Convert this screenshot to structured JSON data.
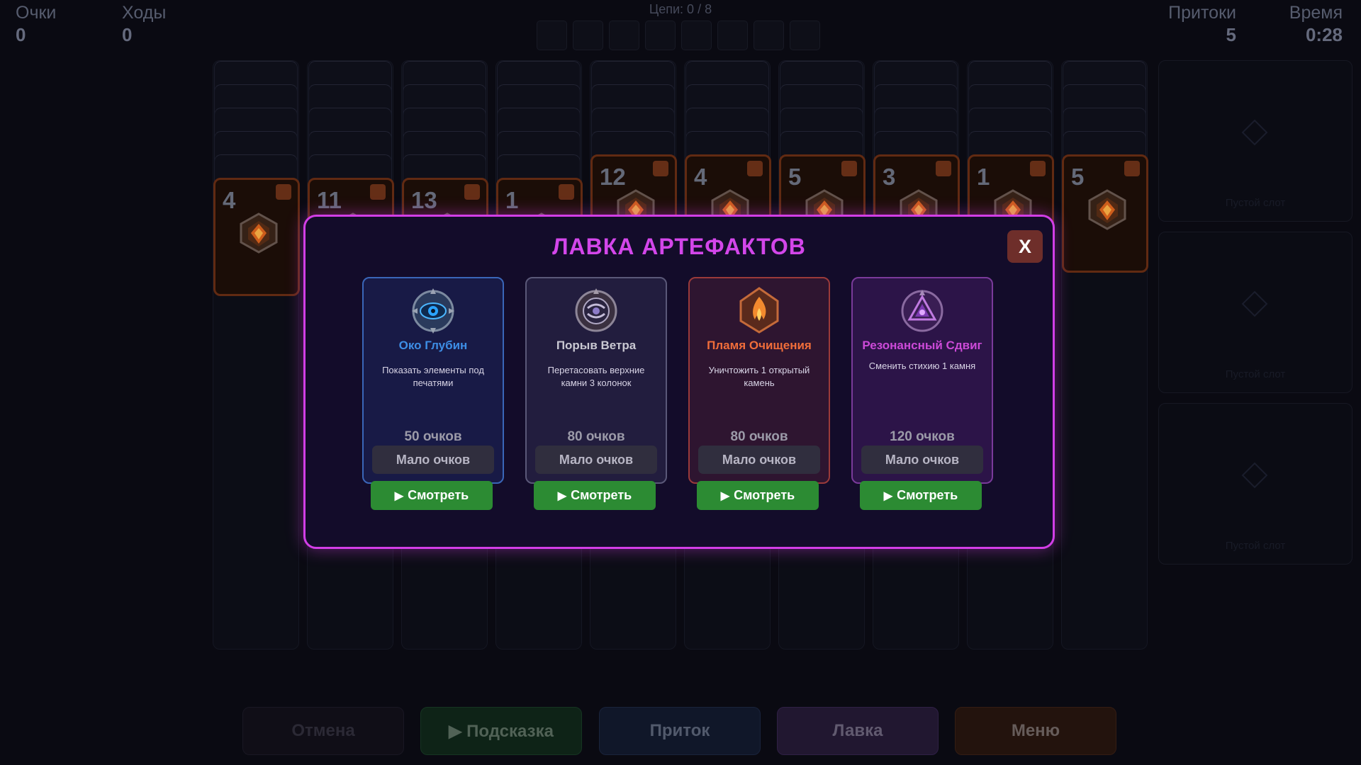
{
  "hud": {
    "score_label": "Очки",
    "score_value": "0",
    "moves_label": "Ходы",
    "moves_value": "0",
    "chains_label": "Цепи: 0 / 8",
    "streams_label": "Притоки",
    "streams_value": "5",
    "time_label": "Время",
    "time_value": "0:28"
  },
  "columns": [
    {
      "facedown": 5,
      "top_value": "4"
    },
    {
      "facedown": 5,
      "top_value": "11"
    },
    {
      "facedown": 5,
      "top_value": "13"
    },
    {
      "facedown": 5,
      "top_value": "1"
    },
    {
      "facedown": 4,
      "top_value": "12"
    },
    {
      "facedown": 4,
      "top_value": "4"
    },
    {
      "facedown": 4,
      "top_value": "5"
    },
    {
      "facedown": 4,
      "top_value": "3"
    },
    {
      "facedown": 4,
      "top_value": "1"
    },
    {
      "facedown": 4,
      "top_value": "5"
    }
  ],
  "empty_slots": [
    {
      "label": "Пустой слот"
    },
    {
      "label": "Пустой слот"
    },
    {
      "label": "Пустой слот"
    }
  ],
  "shop": {
    "title": "ЛАВКА АРТЕФАКТОВ",
    "close_label": "X",
    "items": [
      {
        "name": "Око Глубин",
        "desc": "Показать элементы под печатями",
        "price": "50 очков",
        "status": "Мало очков",
        "watch": "Смотреть",
        "icon": "eye-icon",
        "accent": "#3d8ee6"
      },
      {
        "name": "Порыв Ветра",
        "desc": "Перетасовать верхние камни 3 колонок",
        "price": "80 очков",
        "status": "Мало очков",
        "watch": "Смотреть",
        "icon": "wind-icon",
        "accent": "#c9c8d2"
      },
      {
        "name": "Пламя Очищения",
        "desc": "Уничтожить 1 открытый камень",
        "price": "80 очков",
        "status": "Мало очков",
        "watch": "Смотреть",
        "icon": "flame-icon",
        "accent": "#f06d3a"
      },
      {
        "name": "Резонансный Сдвиг",
        "desc": "Сменить стихию 1 камня",
        "price": "120 очков",
        "status": "Мало очков",
        "watch": "Смотреть",
        "icon": "resonance-icon",
        "accent": "#cc4ad8"
      }
    ]
  },
  "buttons": {
    "undo": "Отмена",
    "hint": "▶ Подсказка",
    "stream": "Приток",
    "shop": "Лавка",
    "menu": "Меню"
  }
}
